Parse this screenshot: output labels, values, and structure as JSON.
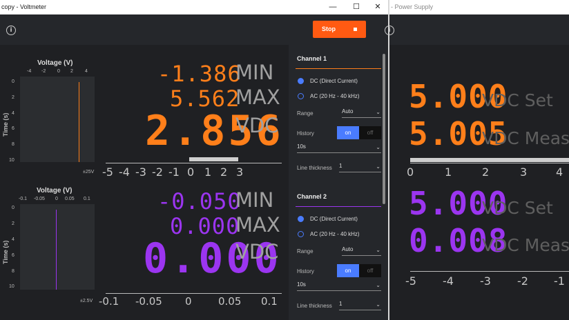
{
  "left_window": {
    "title": "copy - Voltmeter",
    "controls": {
      "minimize": "—",
      "maximize": "☐",
      "close": "✕"
    },
    "stop_button": {
      "label": "Stop"
    },
    "channel1_display": {
      "plot_title": "Voltage (V)",
      "x_ticks": [
        "-4",
        "-2",
        "0",
        "2",
        "4"
      ],
      "y_label": "Time (s)",
      "y_ticks": [
        "0",
        "2",
        "4",
        "6",
        "8",
        "10"
      ],
      "range_label": "±25V",
      "min_value": "-1.386",
      "min_label": "MIN",
      "max_value": "5.562",
      "max_label": "MAX",
      "main_value": "2.856",
      "main_unit": "VDC",
      "scale_ticks": [
        "-5",
        "-4",
        "-3",
        "-2",
        "-1",
        "0",
        "1",
        "2",
        "3"
      ],
      "bar_level": 0.2
    },
    "channel2_display": {
      "plot_title": "Voltage (V)",
      "x_ticks": [
        "-0.1",
        "-0.05",
        "0",
        "0.05",
        "0.1"
      ],
      "y_label": "Time (s)",
      "y_ticks": [
        "0",
        "2",
        "4",
        "6",
        "8",
        "10"
      ],
      "range_label": "±2.5V",
      "min_value": "-0.050",
      "min_label": "MIN",
      "max_value": "0.000",
      "max_label": "MAX",
      "main_value": "0.000",
      "main_unit": "VDC",
      "scale_ticks": [
        "-0.1",
        "-0.05",
        "0",
        "0.05",
        "0.1"
      ]
    },
    "settings": {
      "ch1": {
        "title": "Channel 1",
        "dc_label": "DC (Direct Current)",
        "ac_label": "AC (20 Hz - 40 kHz)",
        "range_label": "Range",
        "range_value": "Auto",
        "history_label": "History",
        "history_on": "on",
        "history_off": "off",
        "history_value": "10s",
        "thickness_label": "Line thickness",
        "thickness_value": "1"
      },
      "ch2": {
        "title": "Channel 2",
        "dc_label": "DC (Direct Current)",
        "ac_label": "AC (20 Hz - 40 kHz)",
        "range_label": "Range",
        "range_value": "Auto",
        "history_label": "History",
        "history_on": "on",
        "history_off": "off",
        "history_value": "10s",
        "thickness_label": "Line thickness",
        "thickness_value": "1"
      }
    }
  },
  "right_window": {
    "title": "- Power Supply",
    "ch1": {
      "set_value": "5.000",
      "set_label": "VDC  Set",
      "meas_value": "5.005",
      "meas_label": "VDC  Meas"
    },
    "ch1_scale": [
      "0",
      "1",
      "2",
      "3",
      "4"
    ],
    "ch2": {
      "set_value": "5.000",
      "set_label": "VDC  Set",
      "meas_value": "0.008",
      "meas_label": "VDC  Meas"
    },
    "ch2_scale": [
      "-5",
      "-4",
      "-3",
      "-2",
      "-1"
    ]
  },
  "colors": {
    "ch1": "#ff7f1a",
    "ch2": "#9b35f0",
    "accent": "#4a7cff",
    "stop": "#ff5a12"
  }
}
